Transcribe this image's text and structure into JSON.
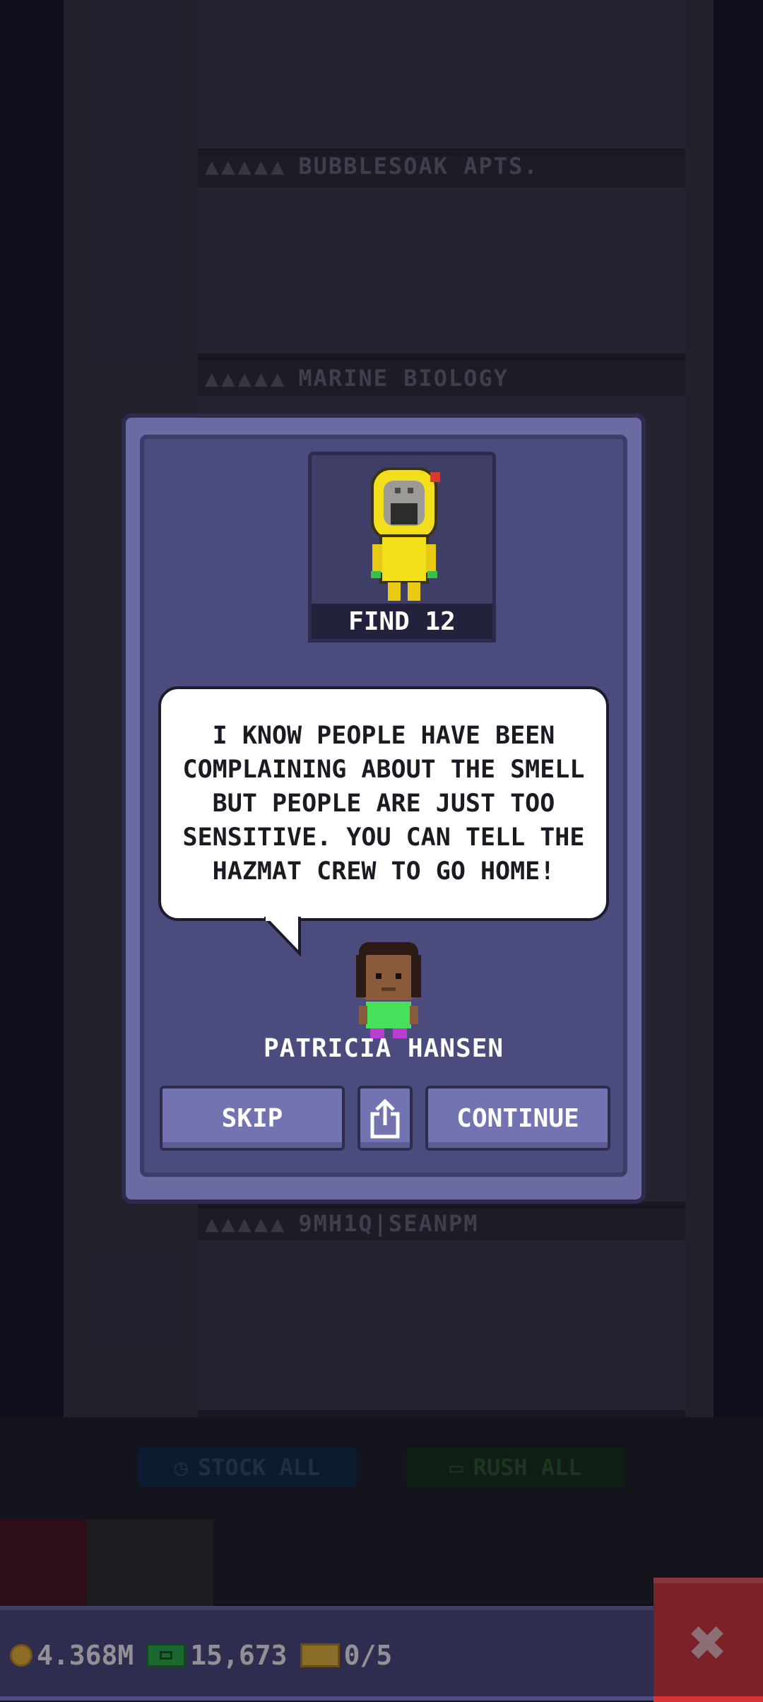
{
  "background": {
    "floors": [
      {
        "label": "BUBBLESOAK APTS."
      },
      {
        "label": "MARINE BIOLOGY"
      },
      {
        "label": "9MH1Q|SEANPM"
      }
    ],
    "star_glyphs": "▲▲▲▲▲",
    "stock_all_label": "STOCK ALL",
    "rush_all_label": "RUSH ALL"
  },
  "dialog": {
    "find_label": "FIND 12",
    "quote": "I KNOW PEOPLE HAVE BEEN COMPLAINING ABOUT THE SMELL BUT PEOPLE ARE JUST TOO SENSITIVE. YOU CAN TELL THE HAZMAT CREW TO GO HOME!",
    "speaker_name": "PATRICIA HANSEN",
    "skip_label": "SKIP",
    "continue_label": "CONTINUE"
  },
  "hud": {
    "coins": "4.368M",
    "bux": "15,673",
    "tickets": "0/5"
  },
  "colors": {
    "modal": "#6b6aa3",
    "modal_inner": "#4c4b7d",
    "button": "#7473b1",
    "hud": "#4d4c80",
    "close": "#d9343a",
    "hazmat_yellow": "#f2de1b"
  },
  "icons": {
    "share": "share-icon",
    "close": "close-icon",
    "coin": "coin-icon",
    "bux": "bux-icon",
    "ticket": "ticket-icon"
  }
}
